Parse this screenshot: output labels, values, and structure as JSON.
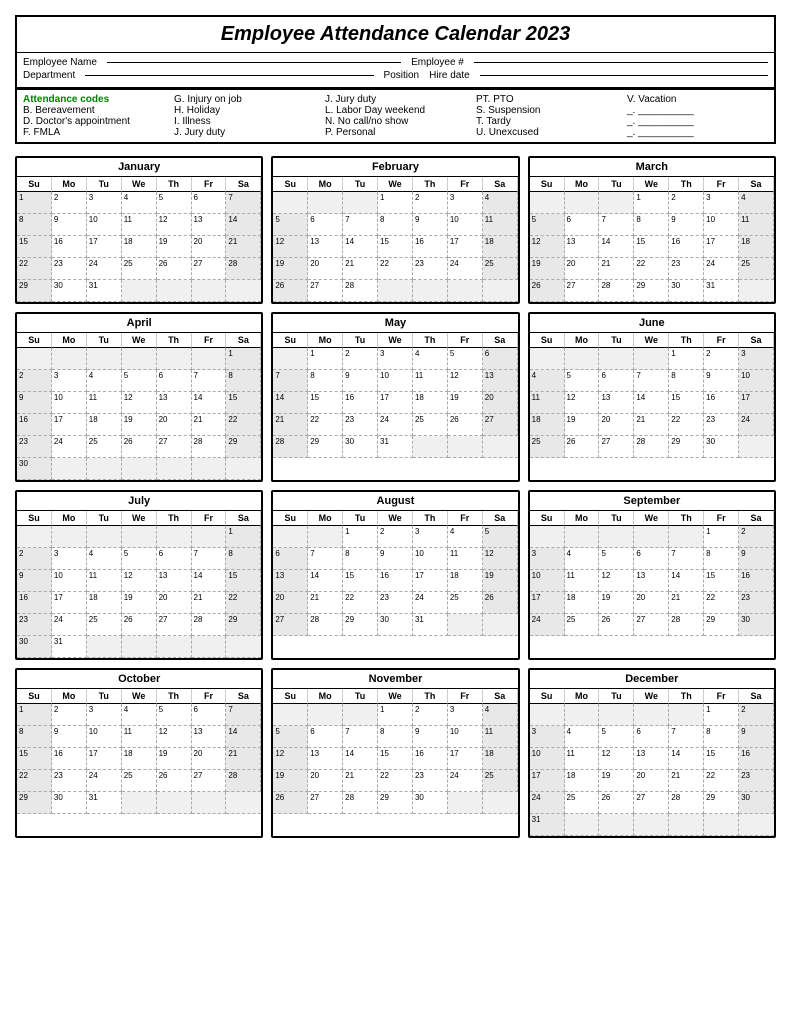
{
  "title": "Employee Attendance Calendar 2023",
  "header": {
    "employee_name_label": "Employee Name",
    "department_label": "Department",
    "position_label": "Position",
    "employee_num_label": "Employee #",
    "hire_date_label": "Hire date"
  },
  "codes": {
    "header": "Attendance codes",
    "items": [
      "B. Bereavement",
      "D. Doctor's appointment",
      "F.  FMLA",
      "G. Injury on job",
      "H. Holiday",
      "I.  Illness",
      "J. Jury duty",
      "J. Jury duty",
      "L. Labor Day weekend",
      "N. No call/no show",
      "P. Personal",
      "PT. PTO",
      "S. Suspension",
      "T. Tardy",
      "U. Unexcused",
      "V. Vacation",
      "_.  __________",
      "_.  __________",
      "_.  __________",
      "."
    ]
  },
  "months": [
    {
      "name": "January",
      "days": [
        1,
        2,
        3,
        4,
        5,
        6,
        7,
        8,
        9,
        10,
        11,
        12,
        13,
        14,
        15,
        16,
        17,
        18,
        19,
        20,
        21,
        22,
        23,
        24,
        25,
        26,
        27,
        28,
        29,
        30,
        31
      ],
      "startDay": 0,
      "totalDays": 31
    },
    {
      "name": "February",
      "days": [
        1,
        2,
        3,
        4,
        5,
        6,
        7,
        8,
        9,
        10,
        11,
        12,
        13,
        14,
        15,
        16,
        17,
        18,
        19,
        20,
        21,
        22,
        23,
        24,
        25,
        26,
        27,
        28
      ],
      "startDay": 3,
      "totalDays": 28
    },
    {
      "name": "March",
      "days": [
        1,
        2,
        3,
        4,
        5,
        6,
        7,
        8,
        9,
        10,
        11,
        12,
        13,
        14,
        15,
        16,
        17,
        18,
        19,
        20,
        21,
        22,
        23,
        24,
        25,
        26,
        27,
        28,
        29,
        30,
        31
      ],
      "startDay": 3,
      "totalDays": 31
    },
    {
      "name": "April",
      "days": [
        1,
        2,
        3,
        4,
        5,
        6,
        7,
        8,
        9,
        10,
        11,
        12,
        13,
        14,
        15,
        16,
        17,
        18,
        19,
        20,
        21,
        22,
        23,
        24,
        25,
        26,
        27,
        28,
        29,
        30
      ],
      "startDay": 6,
      "totalDays": 30
    },
    {
      "name": "May",
      "days": [
        1,
        2,
        3,
        4,
        5,
        6,
        7,
        8,
        9,
        10,
        11,
        12,
        13,
        14,
        15,
        16,
        17,
        18,
        19,
        20,
        21,
        22,
        23,
        24,
        25,
        26,
        27,
        28,
        29,
        30,
        31
      ],
      "startDay": 1,
      "totalDays": 31
    },
    {
      "name": "June",
      "days": [
        1,
        2,
        3,
        4,
        5,
        6,
        7,
        8,
        9,
        10,
        11,
        12,
        13,
        14,
        15,
        16,
        17,
        18,
        19,
        20,
        21,
        22,
        23,
        24,
        25,
        26,
        27,
        28,
        29,
        30
      ],
      "startDay": 4,
      "totalDays": 30
    },
    {
      "name": "July",
      "days": [
        1,
        2,
        3,
        4,
        5,
        6,
        7,
        8,
        9,
        10,
        11,
        12,
        13,
        14,
        15,
        16,
        17,
        18,
        19,
        20,
        21,
        22,
        23,
        24,
        25,
        26,
        27,
        28,
        29,
        30,
        31
      ],
      "startDay": 6,
      "totalDays": 31
    },
    {
      "name": "August",
      "days": [
        1,
        2,
        3,
        4,
        5,
        6,
        7,
        8,
        9,
        10,
        11,
        12,
        13,
        14,
        15,
        16,
        17,
        18,
        19,
        20,
        21,
        22,
        23,
        24,
        25,
        26,
        27,
        28,
        29,
        30,
        31
      ],
      "startDay": 2,
      "totalDays": 31
    },
    {
      "name": "September",
      "days": [
        1,
        2,
        3,
        4,
        5,
        6,
        7,
        8,
        9,
        10,
        11,
        12,
        13,
        14,
        15,
        16,
        17,
        18,
        19,
        20,
        21,
        22,
        23,
        24,
        25,
        26,
        27,
        28,
        29,
        30
      ],
      "startDay": 5,
      "totalDays": 30
    },
    {
      "name": "October",
      "days": [
        1,
        2,
        3,
        4,
        5,
        6,
        7,
        8,
        9,
        10,
        11,
        12,
        13,
        14,
        15,
        16,
        17,
        18,
        19,
        20,
        21,
        22,
        23,
        24,
        25,
        26,
        27,
        28,
        29,
        30,
        31
      ],
      "startDay": 0,
      "totalDays": 31
    },
    {
      "name": "November",
      "days": [
        1,
        2,
        3,
        4,
        5,
        6,
        7,
        8,
        9,
        10,
        11,
        12,
        13,
        14,
        15,
        16,
        17,
        18,
        19,
        20,
        21,
        22,
        23,
        24,
        25,
        26,
        27,
        28,
        29,
        30
      ],
      "startDay": 3,
      "totalDays": 30
    },
    {
      "name": "December",
      "days": [
        1,
        2,
        3,
        4,
        5,
        6,
        7,
        8,
        9,
        10,
        11,
        12,
        13,
        14,
        15,
        16,
        17,
        18,
        19,
        20,
        21,
        22,
        23,
        24,
        25,
        26,
        27,
        28,
        29,
        30,
        31
      ],
      "startDay": 5,
      "totalDays": 31
    }
  ],
  "day_headers": [
    "Su",
    "Mo",
    "Tu",
    "We",
    "Th",
    "Fr",
    "Sa"
  ]
}
